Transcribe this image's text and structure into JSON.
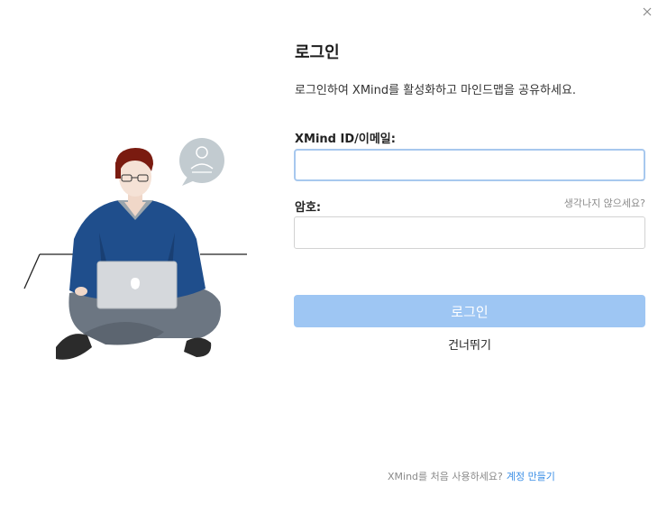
{
  "dialog": {
    "title": "로그인",
    "subtitle": "로그인하여 XMind를 활성화하고 마인드맵을 공유하세요.",
    "close_icon": "close-icon"
  },
  "form": {
    "id_label": "XMind ID/이메일:",
    "id_value": "",
    "password_label": "암호:",
    "password_value": "",
    "forgot_link": "생각나지 않으세요?",
    "login_button": "로그인",
    "skip_link": "건너뛰기"
  },
  "footer": {
    "prompt": "XMind를 처음 사용하세요?",
    "create_account_link": "계정 만들기"
  },
  "colors": {
    "login_button_bg": "#9ec6f3",
    "link_blue": "#3a8ee6",
    "focused_border": "#a7c8ee",
    "sweater": "#1f4e8c"
  },
  "illustration": {
    "description_icon": "person-with-laptop-illustration",
    "bubble_icon": "user-speech-bubble-icon"
  }
}
